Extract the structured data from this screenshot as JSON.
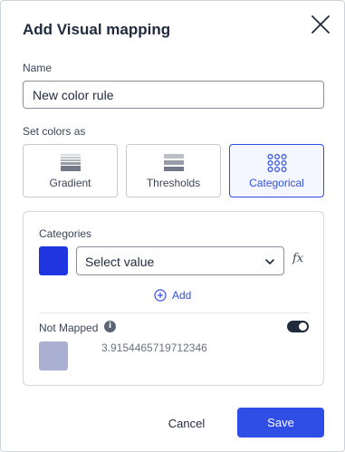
{
  "dialog": {
    "title": "Add Visual mapping",
    "close_icon": "close-icon"
  },
  "name_field": {
    "label": "Name",
    "value": "New color rule"
  },
  "set_colors": {
    "label": "Set colors as",
    "options": [
      {
        "label": "Gradient",
        "icon": "gradient-icon",
        "selected": false
      },
      {
        "label": "Thresholds",
        "icon": "thresholds-icon",
        "selected": false
      },
      {
        "label": "Categorical",
        "icon": "categorical-icon",
        "selected": true
      }
    ]
  },
  "categories": {
    "label": "Categories",
    "swatch_color": "#1f35e0",
    "select_value": "Select value",
    "fx_label": "fx",
    "add_label": "Add"
  },
  "not_mapped": {
    "label": "Not Mapped",
    "info_icon": "info-icon",
    "toggle_on": true,
    "swatch_color": "#aab0d2",
    "value": "3.9154465719712346"
  },
  "footer": {
    "cancel_label": "Cancel",
    "save_label": "Save"
  },
  "colors": {
    "accent": "#2e4ee6",
    "text": "#1f2a3d"
  }
}
